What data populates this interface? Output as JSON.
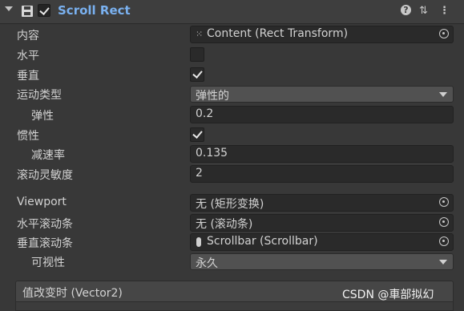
{
  "component": {
    "title": "Scroll Rect",
    "enabled": true,
    "help_icon": "help-icon",
    "preset_icon": "presets-icon",
    "menu_icon": "kebab-menu-icon"
  },
  "fields": {
    "content": {
      "label": "内容",
      "value": "Content (Rect Transform)"
    },
    "horizontal": {
      "label": "水平",
      "checked": false
    },
    "vertical": {
      "label": "垂直",
      "checked": true
    },
    "movement_type": {
      "label": "运动类型",
      "value": "弹性的"
    },
    "elasticity": {
      "label": "弹性",
      "value": "0.2"
    },
    "inertia": {
      "label": "惯性",
      "checked": true
    },
    "deceleration_rate": {
      "label": "减速率",
      "value": "0.135"
    },
    "scroll_sensitivity": {
      "label": "滚动灵敏度",
      "value": "2"
    },
    "viewport": {
      "label": "Viewport",
      "value": "无 (矩形变换)"
    },
    "horizontal_scrollbar": {
      "label": "水平滚动条",
      "value": "无 (滚动条)"
    },
    "vertical_scrollbar": {
      "label": "垂直滚动条",
      "value": "Scrollbar (Scrollbar)"
    },
    "visibility": {
      "label": "可视性",
      "value": "永久"
    }
  },
  "event": {
    "title": "值改变时 (Vector2)"
  },
  "watermark": "CSDN @車部拟幻",
  "colors": {
    "background": "#383838",
    "title_blue": "#7ab1f0",
    "field": "#2a2a2a",
    "dropdown": "#515151"
  }
}
